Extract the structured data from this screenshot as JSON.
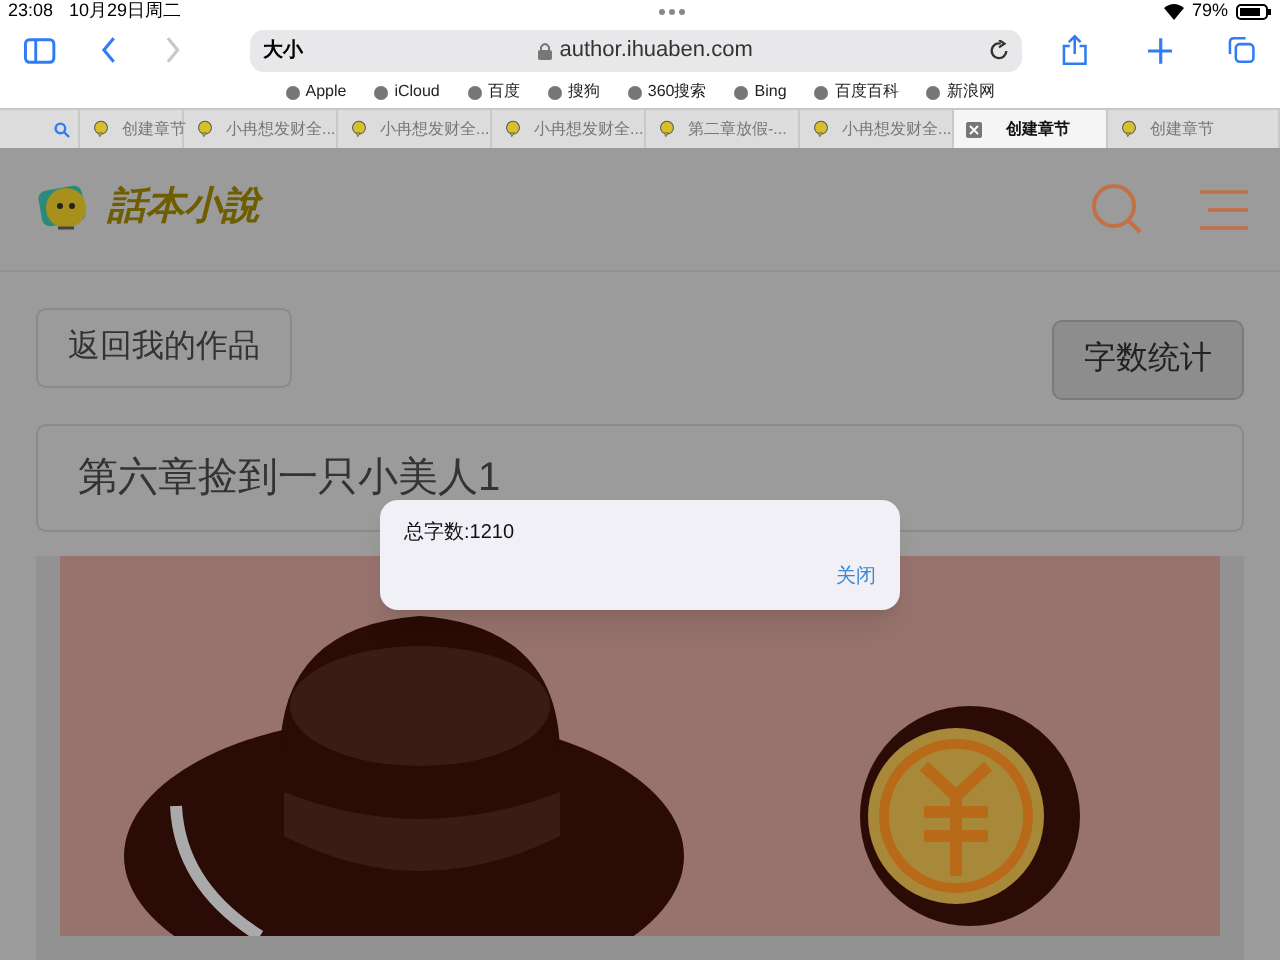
{
  "status_bar": {
    "time": "23:08",
    "date": "10月29日周二",
    "battery": "79%"
  },
  "toolbar": {
    "text_size": "大小",
    "address": "author.ihuaben.com"
  },
  "bookmarks": [
    "Apple",
    "iCloud",
    "百度",
    "搜狗",
    "360搜索",
    "Bing",
    "百度百科",
    "新浪网"
  ],
  "tabs": [
    {
      "label": "创建章节",
      "selected": false
    },
    {
      "label": "小冉想发财全...",
      "selected": false
    },
    {
      "label": "小冉想发财全...",
      "selected": false
    },
    {
      "label": "小冉想发财全...",
      "selected": false
    },
    {
      "label": "第二章放假-...",
      "selected": false
    },
    {
      "label": "小冉想发财全...",
      "selected": false
    },
    {
      "label": "创建章节",
      "selected": true
    },
    {
      "label": "创建章节",
      "selected": false
    }
  ],
  "site": {
    "logo_text": "話本小說"
  },
  "buttons": {
    "back": "返回我的作品",
    "word_count": "字数统计"
  },
  "chapter_title": "第六章捡到一只小美人1",
  "dialog": {
    "message": "总字数:1210",
    "close": "关闭"
  }
}
